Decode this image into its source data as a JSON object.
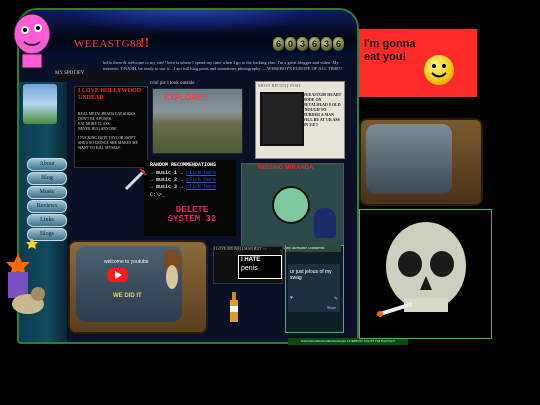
{
  "header": {
    "site_title": "WEEASTG88",
    "title_exclaim": "!!",
    "counter": [
      "6",
      "0",
      "3",
      "6",
      "3",
      "6"
    ]
  },
  "intro": {
    "text": "hello there & welcome to my site!! here is where I spend my time when I go to the fucking clue. I'm a great blogger and video. My interests: T-RASH, be ready to use it... I am full blog posts and sometimes photography — WEREBOYS EUROPE OF ALL TIME!!"
  },
  "nav": {
    "items": [
      {
        "label": "About"
      },
      {
        "label": "Blog"
      },
      {
        "label": "Music"
      },
      {
        "label": "Reviews"
      },
      {
        "label": "Links"
      },
      {
        "label": "Blogs"
      }
    ]
  },
  "spotify_label": "MY SPOTIFY",
  "love_panel": {
    "title": "I LOVE HOLLYWOOD UNDEAD",
    "list": [
      "REAL METALHEADS EAT SOCKS",
      "DON'T BE A POSER",
      "EAT MORE CLASS",
      "NEVER HUG ANYONE"
    ],
    "footer": "I FUCKING HATE TAYLOR SWIFT SHE'S SO CRINGE SHE MAKES ME WANT TO KILL MYSELF."
  },
  "cool_pic": {
    "label": "cool pic i took outside",
    "overlay": "EXPLORE!!"
  },
  "recent": {
    "header": "MOST RECENT POST",
    "text": "WEEASTG88 HEART MODE ON METALHEAD 8 OLD ENOUGH TO MURDER A MAN WILL BE AT UR ASS ON 3/4!!!"
  },
  "random": {
    "header": "RANDOM RECOMMENDATIONS",
    "items": [
      {
        "label": "→ music 1 →",
        "link": "click here"
      },
      {
        "label": "→ music 2 →",
        "link": "click here"
      },
      {
        "label": "→ music 3 →",
        "link": "click here"
      }
    ],
    "prompt": "C:\\>_",
    "delete_text": "DELETE SYSTEM 32"
  },
  "cartoon": {
    "title": "MISSING MIRANDA"
  },
  "tv_left": {
    "yt_label": "welcome to youtube",
    "we_did_it": "WE DID IT"
  },
  "balloon": {
    "label": "I LOVE MY BALLMAN BUT >>",
    "hate": "I HATE",
    "penis": "penis"
  },
  "comments": {
    "header": "my awesome comments",
    "message": "ur just jelous of my swag",
    "meta": "Share"
  },
  "bottom_tag": "listthisthatthiswhatthisthatsright CURRENT STUFF I'M HANGIN",
  "eat_panel": {
    "text": "I'm gonna eat you!"
  }
}
